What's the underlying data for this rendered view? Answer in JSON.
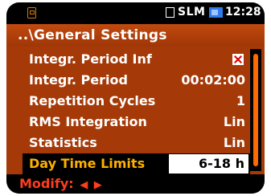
{
  "statusbar": {
    "mode": "SLM",
    "time": "12:28"
  },
  "header": {
    "title": "..\\General Settings"
  },
  "menu": {
    "items": [
      {
        "label": "Integr. Period Inf",
        "value": ""
      },
      {
        "label": "Integr. Period",
        "value": "00:02:00"
      },
      {
        "label": "Repetition Cycles",
        "value": "1"
      },
      {
        "label": "RMS Integration",
        "value": "Lin"
      },
      {
        "label": "Statistics",
        "value": "Lin"
      },
      {
        "label": "Day Time Limits",
        "value": "6-18 h"
      }
    ],
    "selected_index": 5
  },
  "footer": {
    "label": "Modify:",
    "left_arrow": "◀",
    "right_arrow": "▶"
  },
  "colors": {
    "background": "#a53a08",
    "accent_orange": "#ff6a00",
    "selected_label": "#ffb000",
    "footer_text": "#ff3c1e",
    "battery_blue": "#2f7be8"
  }
}
